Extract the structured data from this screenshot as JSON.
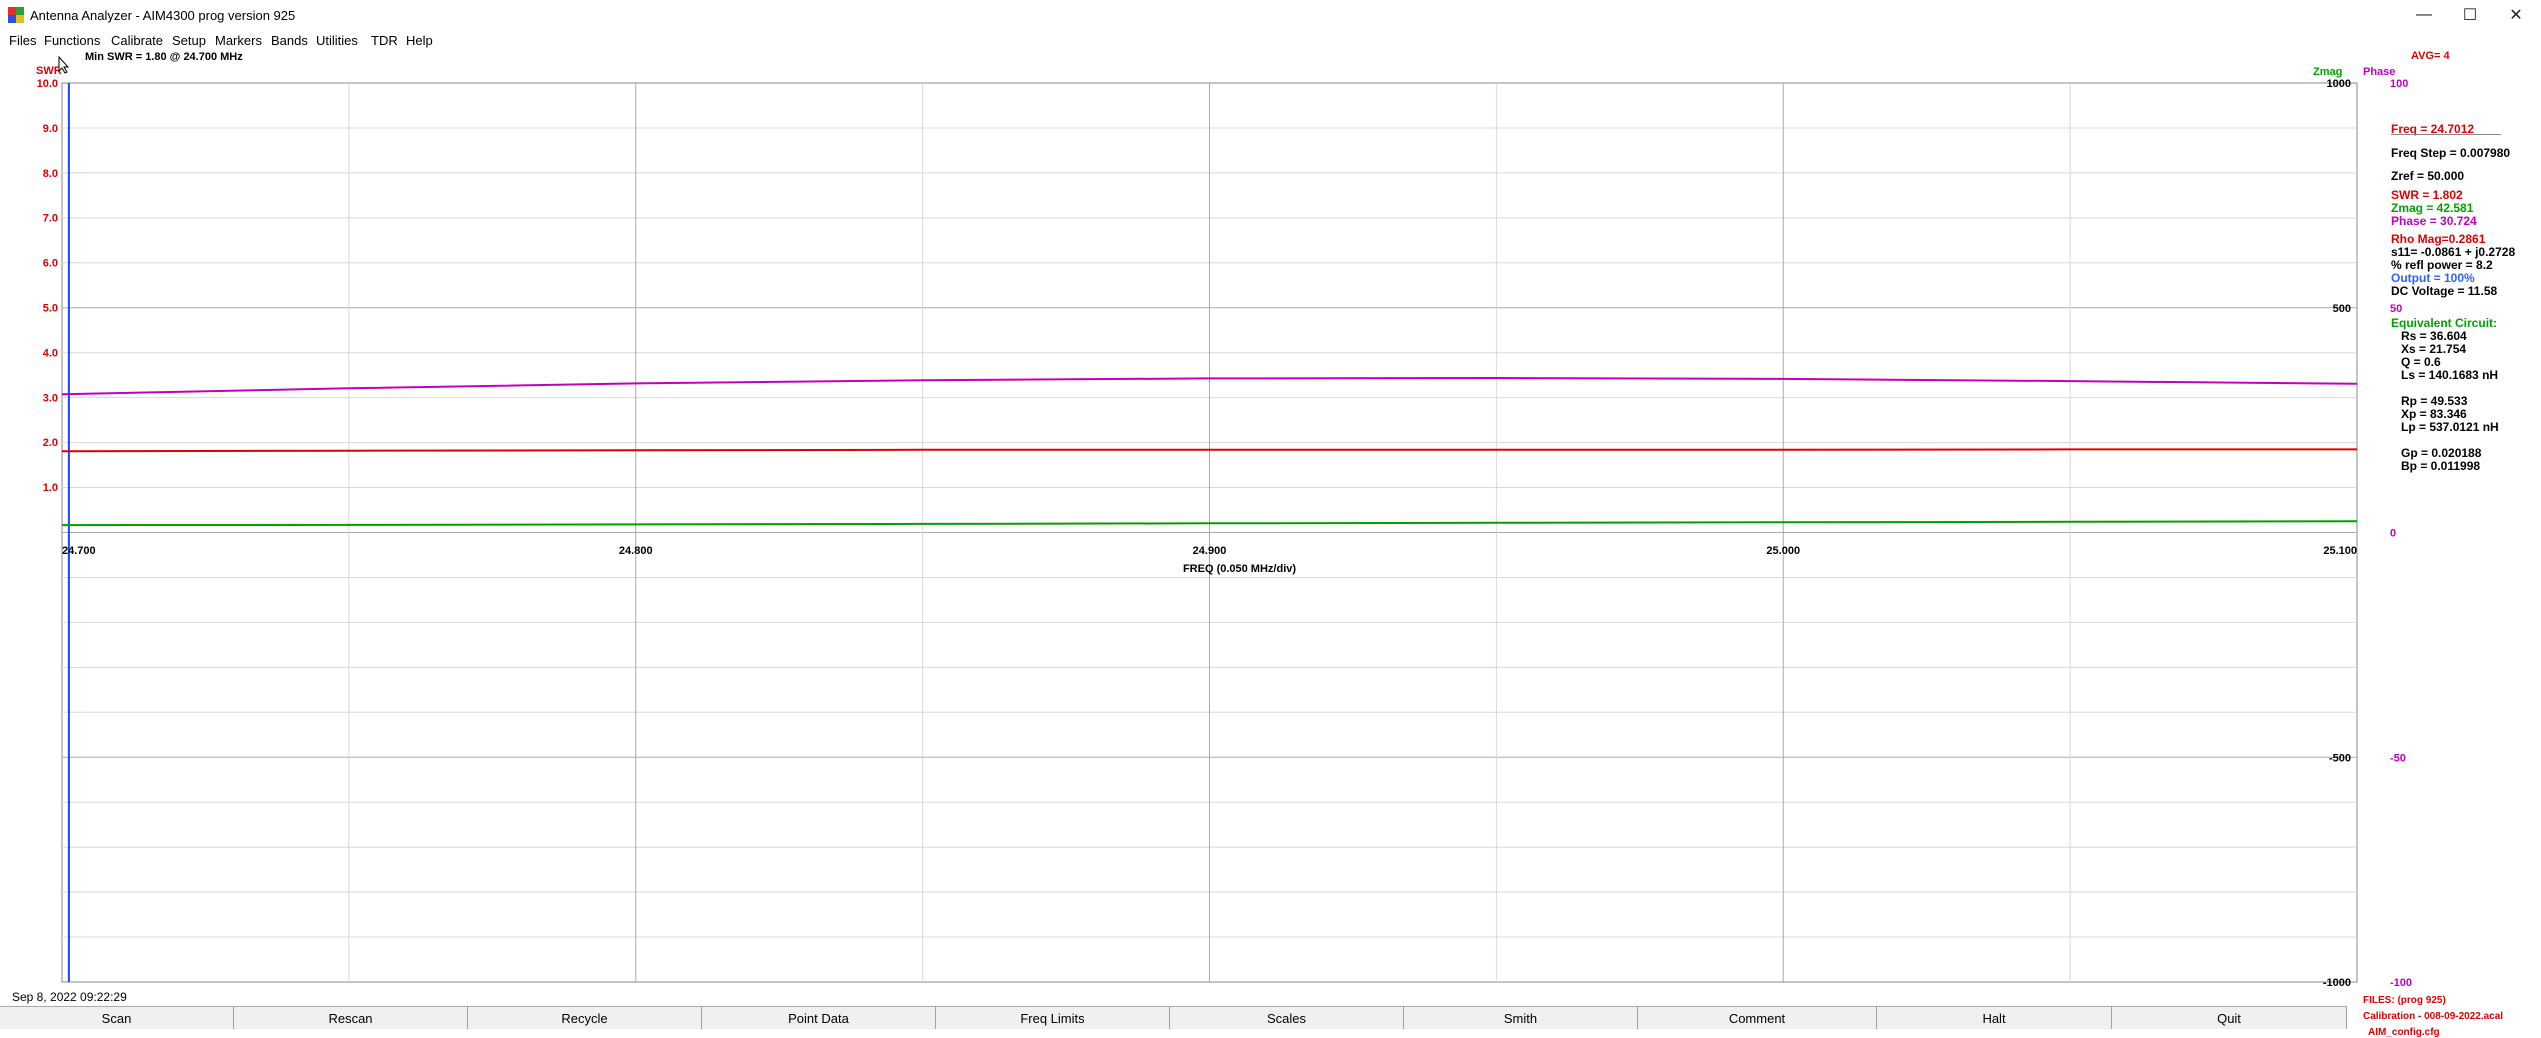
{
  "window": {
    "title": "Antenna Analyzer - AIM4300   prog version 925",
    "minimize": "—",
    "maximize": "☐",
    "close": "✕"
  },
  "menu": [
    "Files",
    "Functions",
    "Calibrate",
    "Setup",
    "Markers",
    "Bands",
    "Utilities",
    "TDR",
    "Help"
  ],
  "header": {
    "min_swr": "Min SWR =   1.80  @  24.700  MHz",
    "swr_label": "SWR",
    "zmag_label": "Zmag",
    "phase_label": "Phase",
    "avg": "AVG=  4"
  },
  "axes": {
    "swr_ticks": [
      "10.0",
      "9.0",
      "8.0",
      "7.0",
      "6.0",
      "5.0",
      "4.0",
      "3.0",
      "2.0",
      "1.0"
    ],
    "zmag_ticks": [
      "1000",
      "500",
      "-500",
      "-1000"
    ],
    "phase_ticks": [
      "100",
      "50",
      "0",
      "-50",
      "-100"
    ],
    "freq_ticks": [
      "24.700",
      "24.800",
      "24.900",
      "25.000",
      "25.100"
    ],
    "xlabel": "FREQ (0.050 MHz/div)"
  },
  "readout": {
    "freq": "Freq = 24.7012",
    "freq_step": "Freq Step = 0.007980",
    "zref": "Zref =   50.000",
    "swr": "SWR  =    1.802",
    "zmag": "Zmag =   42.581",
    "phase": "Phase =   30.724",
    "rho": "Rho Mag=0.2861",
    "s11": "s11= -0.0861 + j0.2728",
    "refl": "% refl power =  8.2",
    "output": "Output =  100%",
    "dc": "DC Voltage =  11.58",
    "equiv": "Equivalent Circuit:",
    "rs": "Rs =   36.604",
    "xs": "Xs =   21.754",
    "q": "Q =   0.6",
    "ls": "Ls =  140.1683  nH",
    "rp": "Rp =   49.533",
    "xp": "Xp =   83.346",
    "lp": "Lp =  537.0121  nH",
    "gp": "Gp =  0.020188",
    "bp": "Bp =  0.011998"
  },
  "files": {
    "line1": "FILES:  (prog 925)",
    "line2": "Calibration - 008-09-2022.acal",
    "line3": "AIM_config.cfg"
  },
  "datetime": "Sep 8, 2022   09:22:29",
  "buttons": [
    "Scan",
    "Rescan",
    "Recycle",
    "Point Data",
    "Freq Limits",
    "Scales",
    "Smith",
    "Comment",
    "Halt",
    "Quit"
  ],
  "colors": {
    "swr": "#e00000",
    "zmag": "#00a000",
    "phase": "#c000c0",
    "output": "#3060ff",
    "grid": "#d8d8d8"
  },
  "chart_data": {
    "type": "line",
    "x": [
      24.7,
      24.75,
      24.8,
      24.85,
      24.9,
      24.95,
      25.0,
      25.05,
      25.1
    ],
    "xlabel": "FREQ (0.050 MHz/div)",
    "series": [
      {
        "name": "SWR",
        "values": [
          1.8,
          1.81,
          1.82,
          1.83,
          1.83,
          1.83,
          1.83,
          1.84,
          1.84
        ]
      },
      {
        "name": "Zmag",
        "values": [
          42.6,
          44,
          47,
          50,
          54,
          57,
          60,
          63,
          67
        ]
      },
      {
        "name": "Phase",
        "values": [
          30.7,
          32,
          33.1,
          33.8,
          34.2,
          34.3,
          34.1,
          33.6,
          33.0
        ]
      }
    ],
    "ylim_swr": [
      0,
      10
    ],
    "ylim_zmag": [
      -1000,
      1000
    ],
    "ylim_phase": [
      -100,
      100
    ]
  }
}
